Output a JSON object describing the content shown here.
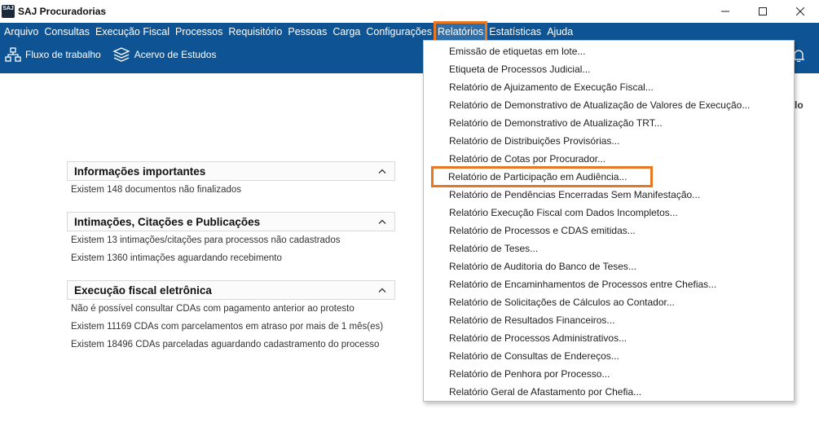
{
  "window": {
    "logo_text": "SAJ",
    "title": "SAJ Procuradorias",
    "controls": [
      "minimize",
      "maximize",
      "close"
    ]
  },
  "menu": {
    "items": [
      "Arquivo",
      "Consultas",
      "Execução Fiscal",
      "Processos",
      "Requisitório",
      "Pessoas",
      "Carga",
      "Configurações",
      "Relatórios",
      "Estatísticas",
      "Ajuda"
    ],
    "active": "Relatórios"
  },
  "toolbar": {
    "fluxo": "Fluxo de trabalho",
    "acervo": "Acervo de Estudos"
  },
  "right_cut_text": "lo",
  "panels": [
    {
      "title": "Informações importantes",
      "lines": [
        "Existem  148 documentos não finalizados"
      ]
    },
    {
      "title": "Intimações, Citações e Publicações",
      "lines": [
        "Existem  13 intimações/citações para processos não cadastrados",
        "Existem  1360 intimações aguardando recebimento"
      ]
    },
    {
      "title": "Execução fiscal eletrônica",
      "lines": [
        "Não é possível consultar CDAs com pagamento anterior ao protesto",
        "Existem  11169 CDAs com parcelamentos em atraso por mais de 1 mês(es)",
        "Existem  18496 CDAs parceladas aguardando cadastramento do processo"
      ]
    }
  ],
  "dropdown": {
    "highlighted_index": 7,
    "items": [
      "Emissão de etiquetas em lote...",
      "Etiqueta de Processos Judicial...",
      "Relatório de Ajuizamento de Execução Fiscal...",
      "Relatório de Demonstrativo de Atualização de Valores de Execução...",
      "Relatório de Demonstrativo de Atualização TRT...",
      "Relatório de Distribuições Provisórias...",
      "Relatório de Cotas por Procurador...",
      "Relatório de Participação em Audiência...",
      "Relatório de Pendências Encerradas Sem Manifestação...",
      "Relatório Execução Fiscal com Dados Incompletos...",
      "Relatório de Processos e CDAS emitidas...",
      "Relatório de Teses...",
      "Relatório de Auditoria do Banco de Teses...",
      "Relatório de Encaminhamentos de Processos entre Chefias...",
      "Relatório de Solicitações de Cálculos ao Contador...",
      "Relatório de Resultados Financeiros...",
      "Relatório de Processos Administrativos...",
      "Relatório de Consultas de Endereços...",
      "Relatório de Penhora por Processo...",
      "Relatório Geral de Afastamento por Chefia..."
    ]
  },
  "colors": {
    "menubar": "#0e5494",
    "highlight_outline": "#e87722"
  }
}
